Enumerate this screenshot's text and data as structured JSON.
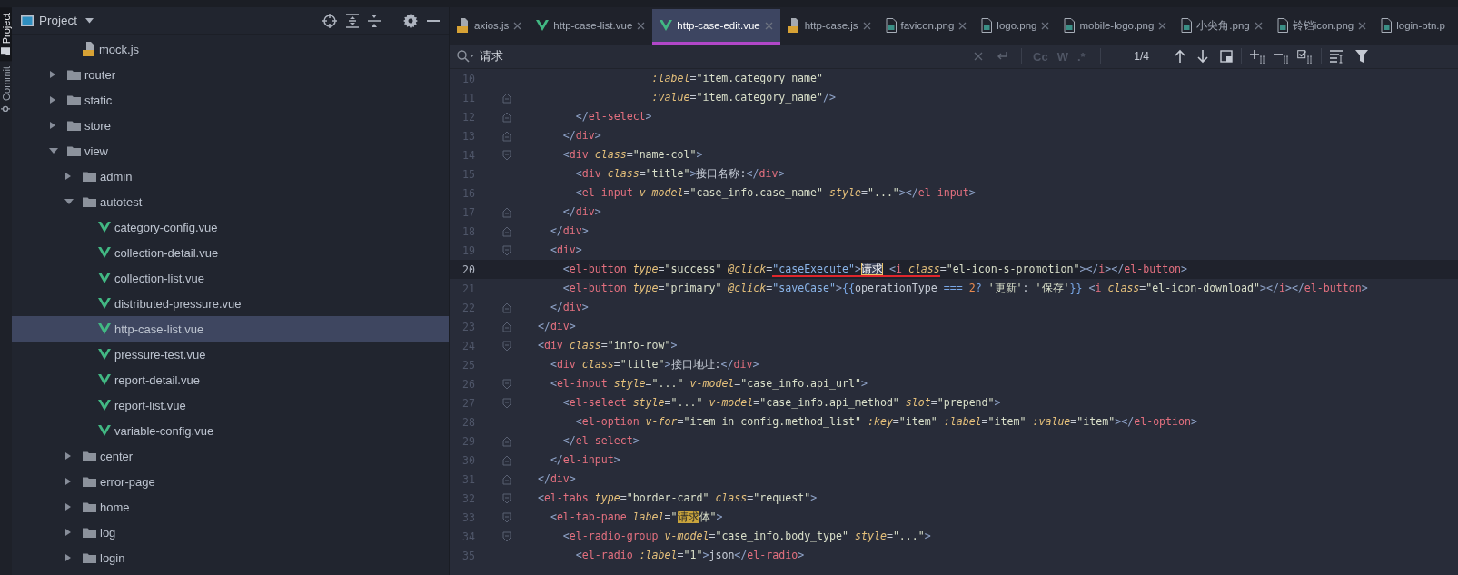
{
  "tool_windows": [
    {
      "label": "Project",
      "kind": "project",
      "selected": true
    },
    {
      "label": "Commit",
      "kind": "commit",
      "selected": false
    }
  ],
  "project": {
    "title": "Project",
    "tree": [
      {
        "children": [
          {
            "label": "mock.js",
            "kind": "js",
            "selected": false
          }
        ]
      },
      {
        "label": "router",
        "kind": "folder",
        "expanded": false,
        "selected": false
      },
      {
        "label": "static",
        "kind": "folder",
        "expanded": false,
        "selected": false
      },
      {
        "label": "store",
        "kind": "folder",
        "expanded": false,
        "selected": false
      },
      {
        "label": "view",
        "kind": "folder",
        "expanded": true,
        "selected": false,
        "children": [
          {
            "label": "admin",
            "kind": "folder",
            "expanded": false,
            "selected": false
          },
          {
            "label": "autotest",
            "kind": "folder",
            "expanded": true,
            "selected": false,
            "children": [
              {
                "label": "category-config.vue",
                "kind": "vue",
                "selected": false
              },
              {
                "label": "collection-detail.vue",
                "kind": "vue",
                "selected": false
              },
              {
                "label": "collection-list.vue",
                "kind": "vue",
                "selected": false
              },
              {
                "label": "distributed-pressure.vue",
                "kind": "vue",
                "selected": false
              },
              {
                "label": "http-case-list.vue",
                "kind": "vue",
                "selected": true
              },
              {
                "label": "pressure-test.vue",
                "kind": "vue",
                "selected": false
              },
              {
                "label": "report-detail.vue",
                "kind": "vue",
                "selected": false
              },
              {
                "label": "report-list.vue",
                "kind": "vue",
                "selected": false
              },
              {
                "label": "variable-config.vue",
                "kind": "vue",
                "selected": false
              }
            ]
          },
          {
            "label": "center",
            "kind": "folder",
            "expanded": false,
            "selected": false
          },
          {
            "label": "error-page",
            "kind": "folder",
            "expanded": false,
            "selected": false
          },
          {
            "label": "home",
            "kind": "folder",
            "expanded": false,
            "selected": false
          },
          {
            "label": "log",
            "kind": "folder",
            "expanded": false,
            "selected": false
          },
          {
            "label": "login",
            "kind": "folder",
            "expanded": false,
            "selected": false
          }
        ]
      }
    ]
  },
  "editor": {
    "tabs": [
      {
        "label": "axios.js",
        "kind": "js",
        "selected": false,
        "closable": true
      },
      {
        "label": "http-case-list.vue",
        "kind": "vue",
        "selected": false,
        "closable": true
      },
      {
        "label": "http-case-edit.vue",
        "kind": "vue",
        "selected": true,
        "closable": true
      },
      {
        "label": "http-case.js",
        "kind": "js",
        "selected": false,
        "closable": true
      },
      {
        "label": "favicon.png",
        "kind": "png",
        "selected": false,
        "closable": true
      },
      {
        "label": "logo.png",
        "kind": "png",
        "selected": false,
        "closable": true
      },
      {
        "label": "mobile-logo.png",
        "kind": "png",
        "selected": false,
        "closable": true
      },
      {
        "label": "小尖角.png",
        "kind": "png",
        "selected": false,
        "closable": true
      },
      {
        "label": "铃铛icon.png",
        "kind": "png",
        "selected": false,
        "closable": true
      },
      {
        "label": "login-btn.p",
        "kind": "png",
        "selected": false,
        "closable": false
      }
    ],
    "search": {
      "value": "请求",
      "toggles": [
        {
          "label": "Cc",
          "selected": false
        },
        {
          "label": "W",
          "selected": false
        },
        {
          "label": ".*",
          "selected": false
        }
      ],
      "match_count": "1/4"
    },
    "lines": [
      {
        "number": "10",
        "current": false,
        "kind": "plain",
        "segments": [
          {
            "kind": "code",
            "text": "                      :label=\"item.category_name\""
          }
        ]
      },
      {
        "number": "11",
        "current": false,
        "kind": "fold-end",
        "segments": [
          {
            "kind": "code",
            "text": "                      :value=\"item.category_name\"/>"
          }
        ]
      },
      {
        "number": "12",
        "current": false,
        "kind": "fold-end",
        "segments": [
          {
            "kind": "code",
            "text": "          </el-select>"
          }
        ]
      },
      {
        "number": "13",
        "current": false,
        "kind": "fold-end",
        "segments": [
          {
            "kind": "code",
            "text": "        </div>"
          }
        ]
      },
      {
        "number": "14",
        "current": false,
        "kind": "fold-start",
        "segments": [
          {
            "kind": "code",
            "text": "        <div class=\"name-col\">"
          }
        ]
      },
      {
        "number": "15",
        "current": false,
        "kind": "plain",
        "segments": [
          {
            "kind": "code",
            "text": "          <div class=\"title\">接口名称:</div>"
          }
        ]
      },
      {
        "number": "16",
        "current": false,
        "kind": "plain",
        "segments": [
          {
            "kind": "code",
            "text": "          <el-input v-model=\"case_info.case_name\" style=\"...\"></el-input>"
          }
        ]
      },
      {
        "number": "17",
        "current": false,
        "kind": "fold-end",
        "segments": [
          {
            "kind": "code",
            "text": "        </div>"
          }
        ]
      },
      {
        "number": "18",
        "current": false,
        "kind": "fold-end",
        "segments": [
          {
            "kind": "code",
            "text": "      </div>"
          }
        ]
      },
      {
        "number": "19",
        "current": false,
        "kind": "fold-start",
        "segments": [
          {
            "kind": "code",
            "text": "      <div>"
          }
        ]
      },
      {
        "number": "20",
        "current": true,
        "kind": "plain",
        "segments": [
          {
            "kind": "code",
            "text": "        <el-button type=\"success\" @click="
          },
          {
            "kind": "underline",
            "children": [
              {
                "kind": "code",
                "text": "\"caseExecute\">"
              },
              {
                "kind": "match",
                "text": "请求",
                "selected": true
              },
              {
                "kind": "code",
                "text": " <i class"
              }
            ]
          },
          {
            "kind": "code",
            "text": "=\"el-icon-s-promotion\"></i></el-button>"
          }
        ]
      },
      {
        "number": "21",
        "current": false,
        "kind": "plain",
        "segments": [
          {
            "kind": "code",
            "text": "        <el-button type=\"primary\" @click=\"saveCase\">{{operationType === 2? '更新': '保存'}} <i class=\"el-icon-download\"></i></el-button>"
          }
        ]
      },
      {
        "number": "22",
        "current": false,
        "kind": "fold-end",
        "segments": [
          {
            "kind": "code",
            "text": "      </div>"
          }
        ]
      },
      {
        "number": "23",
        "current": false,
        "kind": "fold-end",
        "segments": [
          {
            "kind": "code",
            "text": "    </div>"
          }
        ]
      },
      {
        "number": "24",
        "current": false,
        "kind": "fold-start",
        "segments": [
          {
            "kind": "code",
            "text": "    <div class=\"info-row\">"
          }
        ]
      },
      {
        "number": "25",
        "current": false,
        "kind": "plain",
        "segments": [
          {
            "kind": "code",
            "text": "      <div class=\"title\">接口地址:</div>"
          }
        ]
      },
      {
        "number": "26",
        "current": false,
        "kind": "fold-start",
        "segments": [
          {
            "kind": "code",
            "text": "      <el-input style=\"...\" v-model=\"case_info.api_url\">"
          }
        ]
      },
      {
        "number": "27",
        "current": false,
        "kind": "fold-start",
        "segments": [
          {
            "kind": "code",
            "text": "        <el-select style=\"...\" v-model=\"case_info.api_method\" slot=\"prepend\">"
          }
        ]
      },
      {
        "number": "28",
        "current": false,
        "kind": "plain",
        "segments": [
          {
            "kind": "code",
            "text": "          <el-option v-for=\"item in config.method_list\" :key=\"item\" :label=\"item\" :value=\"item\"></el-option>"
          }
        ]
      },
      {
        "number": "29",
        "current": false,
        "kind": "fold-end",
        "segments": [
          {
            "kind": "code",
            "text": "        </el-select>"
          }
        ]
      },
      {
        "number": "30",
        "current": false,
        "kind": "fold-end",
        "segments": [
          {
            "kind": "code",
            "text": "      </el-input>"
          }
        ]
      },
      {
        "number": "31",
        "current": false,
        "kind": "fold-end",
        "segments": [
          {
            "kind": "code",
            "text": "    </div>"
          }
        ]
      },
      {
        "number": "32",
        "current": false,
        "kind": "fold-start",
        "segments": [
          {
            "kind": "code",
            "text": "    <el-tabs type=\"border-card\" class=\"request\">"
          }
        ]
      },
      {
        "number": "33",
        "current": false,
        "kind": "fold-start",
        "segments": [
          {
            "kind": "code",
            "text": "      <el-tab-pane label=\""
          },
          {
            "kind": "match",
            "text": "请求",
            "selected": false
          },
          {
            "kind": "code",
            "text": "体\">"
          }
        ]
      },
      {
        "number": "34",
        "current": false,
        "kind": "fold-start",
        "segments": [
          {
            "kind": "code",
            "text": "        <el-radio-group v-model=\"case_info.body_type\" style=\"...\">"
          }
        ]
      },
      {
        "number": "35",
        "current": false,
        "kind": "plain",
        "segments": [
          {
            "kind": "code",
            "text": "          <el-radio :label=\"1\">json</el-radio>"
          }
        ]
      }
    ]
  }
}
